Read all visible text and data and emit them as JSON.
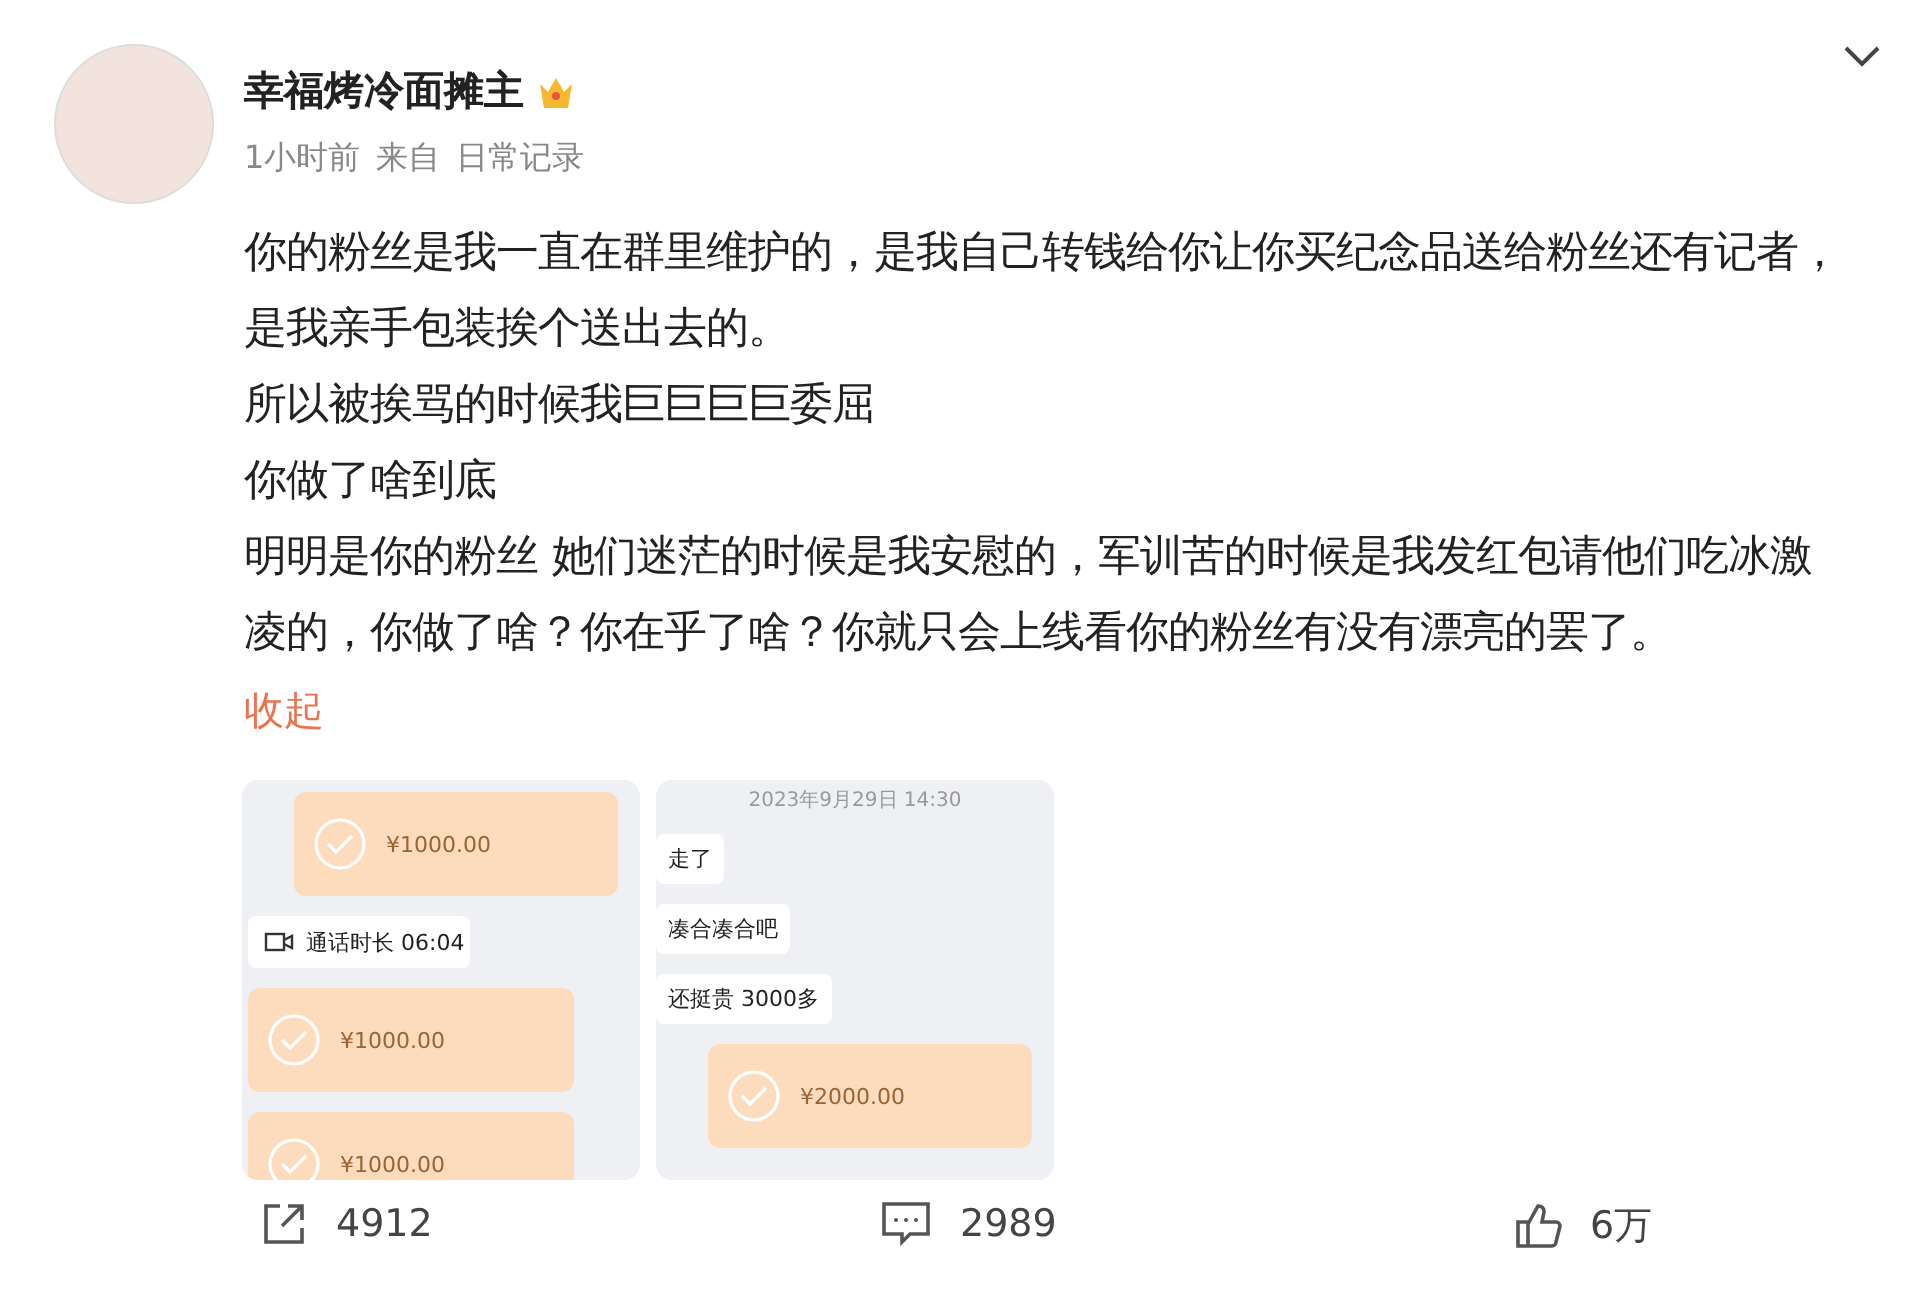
{
  "author": {
    "name": "幸福烤冷面摊主"
  },
  "meta": {
    "time": "1小时前",
    "source_prefix": "来自",
    "source": "日常记录"
  },
  "paragraphs": [
    "你的粉丝是我一直在群里维护的，是我自己转钱给你让你买纪念品送给粉丝还有记者，是我亲手包装挨个送出去的。",
    "所以被挨骂的时候我巨巨巨巨委屈",
    "你做了啥到底",
    "明明是你的粉丝 她们迷茫的时候是我安慰的，军训苦的时候是我发红包请他们吃冰激凌的，你做了啥？你在乎了啥？你就只会上线看你的粉丝有没有漂亮的罢了。"
  ],
  "collapse_link": "收起",
  "images": [
    {
      "items": [
        {
          "kind": "transfer_sent",
          "amount": "¥1000.00"
        },
        {
          "kind": "call",
          "text": "通话时长 06:04"
        },
        {
          "kind": "transfer_received",
          "amount": "¥1000.00"
        },
        {
          "kind": "transfer_received",
          "amount": "¥1000.00"
        }
      ]
    },
    {
      "items": [
        {
          "kind": "date",
          "text": "2023年9月29日 14:30"
        },
        {
          "kind": "bubble",
          "text": "走了"
        },
        {
          "kind": "bubble",
          "text": "凑合凑合吧"
        },
        {
          "kind": "bubble",
          "text": "还挺贵 3000多"
        },
        {
          "kind": "transfer_sent",
          "amount": "¥2000.00"
        }
      ]
    }
  ],
  "actions": [
    {
      "kind": "share",
      "count": "4912"
    },
    {
      "kind": "comment",
      "count": "2989"
    },
    {
      "kind": "like",
      "count": "6万"
    }
  ]
}
